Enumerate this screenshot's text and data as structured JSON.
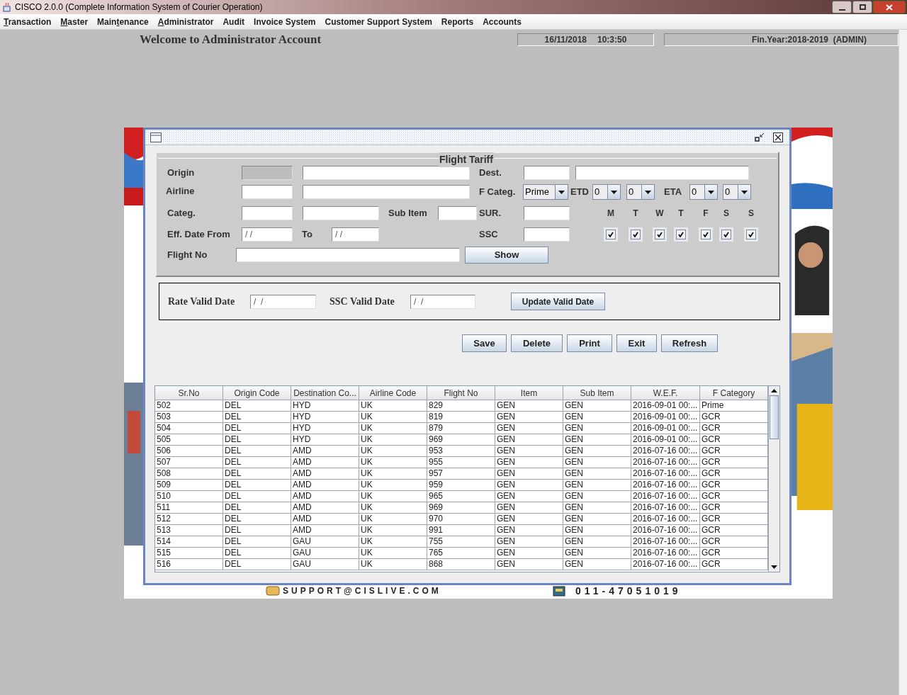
{
  "app_window": {
    "title": "CISCO 2.0.0 (Complete Information System of Courier Operation)"
  },
  "menu": [
    {
      "mnemonic": "T",
      "after": "ransaction"
    },
    {
      "mnemonic": "M",
      "after": "aster"
    },
    {
      "before": "Main",
      "mnemonic": "t",
      "after": "enance"
    },
    {
      "mnemonic": "A",
      "after": "dministrator"
    },
    {
      "label": "Audit"
    },
    {
      "label": "Invoice System"
    },
    {
      "label": "Customer Support System"
    },
    {
      "label": "Reports"
    },
    {
      "label": "Accounts"
    }
  ],
  "header": {
    "welcome": "Welcome to Administrator Account",
    "date": "16/11/2018",
    "time": "10:3:50",
    "fin_year": "Fin.Year:2018-2019  (ADMIN)"
  },
  "footer": {
    "email": "SUPPORT@CISLIVE.COM",
    "phone": "011-47051019"
  },
  "flight_tariff": {
    "title": "Flight Tariff",
    "origin": {
      "label": "Origin",
      "code_disabled": true
    },
    "dest": {
      "label": "Dest."
    },
    "airline": {
      "label": "Airline"
    },
    "f_categ": {
      "label": "F Categ.",
      "value": "Prime"
    },
    "etd": {
      "label": "ETD",
      "hours": "0",
      "minutes": "0"
    },
    "eta": {
      "label": "ETA",
      "hours": "0",
      "minutes": "0"
    },
    "categ": {
      "label": "Categ."
    },
    "sub_item": {
      "label": "Sub Item"
    },
    "sur": {
      "label": "SUR."
    },
    "eff_date_from": {
      "label": "Eff. Date From",
      "value": "/ /"
    },
    "to": {
      "label": "To",
      "value": "/ /"
    },
    "ssc": {
      "label": "SSC"
    },
    "flight_no": {
      "label": "Flight No"
    },
    "show_button": "Show",
    "days": [
      {
        "label": "M",
        "checked": true
      },
      {
        "label": "T",
        "checked": true
      },
      {
        "label": "W",
        "checked": true
      },
      {
        "label": "T",
        "checked": true
      },
      {
        "label": "F",
        "checked": true
      },
      {
        "label": "S",
        "checked": true
      },
      {
        "label": "S",
        "checked": true
      }
    ]
  },
  "valid_dates": {
    "rate_label": "Rate Valid Date",
    "rate_value": "/  /",
    "ssc_label": "SSC Valid Date",
    "ssc_value": "/  /",
    "button": "Update Valid Date"
  },
  "buttons": [
    "Save",
    "Delete",
    "Print",
    "Exit",
    "Refresh"
  ],
  "table": {
    "columns": [
      "Sr.No",
      "Origin Code",
      "Destination Co...",
      "Airline Code",
      "Flight No",
      "Item",
      "Sub Item",
      "W.E.F.",
      "F Category"
    ],
    "rows": [
      [
        "502",
        "DEL",
        "HYD",
        "UK",
        "829",
        "GEN",
        "GEN",
        "2016-09-01 00:...",
        "Prime"
      ],
      [
        "503",
        "DEL",
        "HYD",
        "UK",
        "819",
        "GEN",
        "GEN",
        "2016-09-01 00:...",
        "GCR"
      ],
      [
        "504",
        "DEL",
        "HYD",
        "UK",
        "879",
        "GEN",
        "GEN",
        "2016-09-01 00:...",
        "GCR"
      ],
      [
        "505",
        "DEL",
        "HYD",
        "UK",
        "969",
        "GEN",
        "GEN",
        "2016-09-01 00:...",
        "GCR"
      ],
      [
        "506",
        "DEL",
        "AMD",
        "UK",
        "953",
        "GEN",
        "GEN",
        "2016-07-16 00:...",
        "GCR"
      ],
      [
        "507",
        "DEL",
        "AMD",
        "UK",
        "955",
        "GEN",
        "GEN",
        "2016-07-16 00:...",
        "GCR"
      ],
      [
        "508",
        "DEL",
        "AMD",
        "UK",
        "957",
        "GEN",
        "GEN",
        "2016-07-16 00:...",
        "GCR"
      ],
      [
        "509",
        "DEL",
        "AMD",
        "UK",
        "959",
        "GEN",
        "GEN",
        "2016-07-16 00:...",
        "GCR"
      ],
      [
        "510",
        "DEL",
        "AMD",
        "UK",
        "965",
        "GEN",
        "GEN",
        "2016-07-16 00:...",
        "GCR"
      ],
      [
        "511",
        "DEL",
        "AMD",
        "UK",
        "969",
        "GEN",
        "GEN",
        "2016-07-16 00:...",
        "GCR"
      ],
      [
        "512",
        "DEL",
        "AMD",
        "UK",
        "970",
        "GEN",
        "GEN",
        "2016-07-16 00:...",
        "GCR"
      ],
      [
        "513",
        "DEL",
        "AMD",
        "UK",
        "991",
        "GEN",
        "GEN",
        "2016-07-16 00:...",
        "GCR"
      ],
      [
        "514",
        "DEL",
        "GAU",
        "UK",
        "755",
        "GEN",
        "GEN",
        "2016-07-16 00:...",
        "GCR"
      ],
      [
        "515",
        "DEL",
        "GAU",
        "UK",
        "765",
        "GEN",
        "GEN",
        "2016-07-16 00:...",
        "GCR"
      ],
      [
        "516",
        "DEL",
        "GAU",
        "UK",
        "868",
        "GEN",
        "GEN",
        "2016-07-16 00:...",
        "GCR"
      ]
    ]
  }
}
